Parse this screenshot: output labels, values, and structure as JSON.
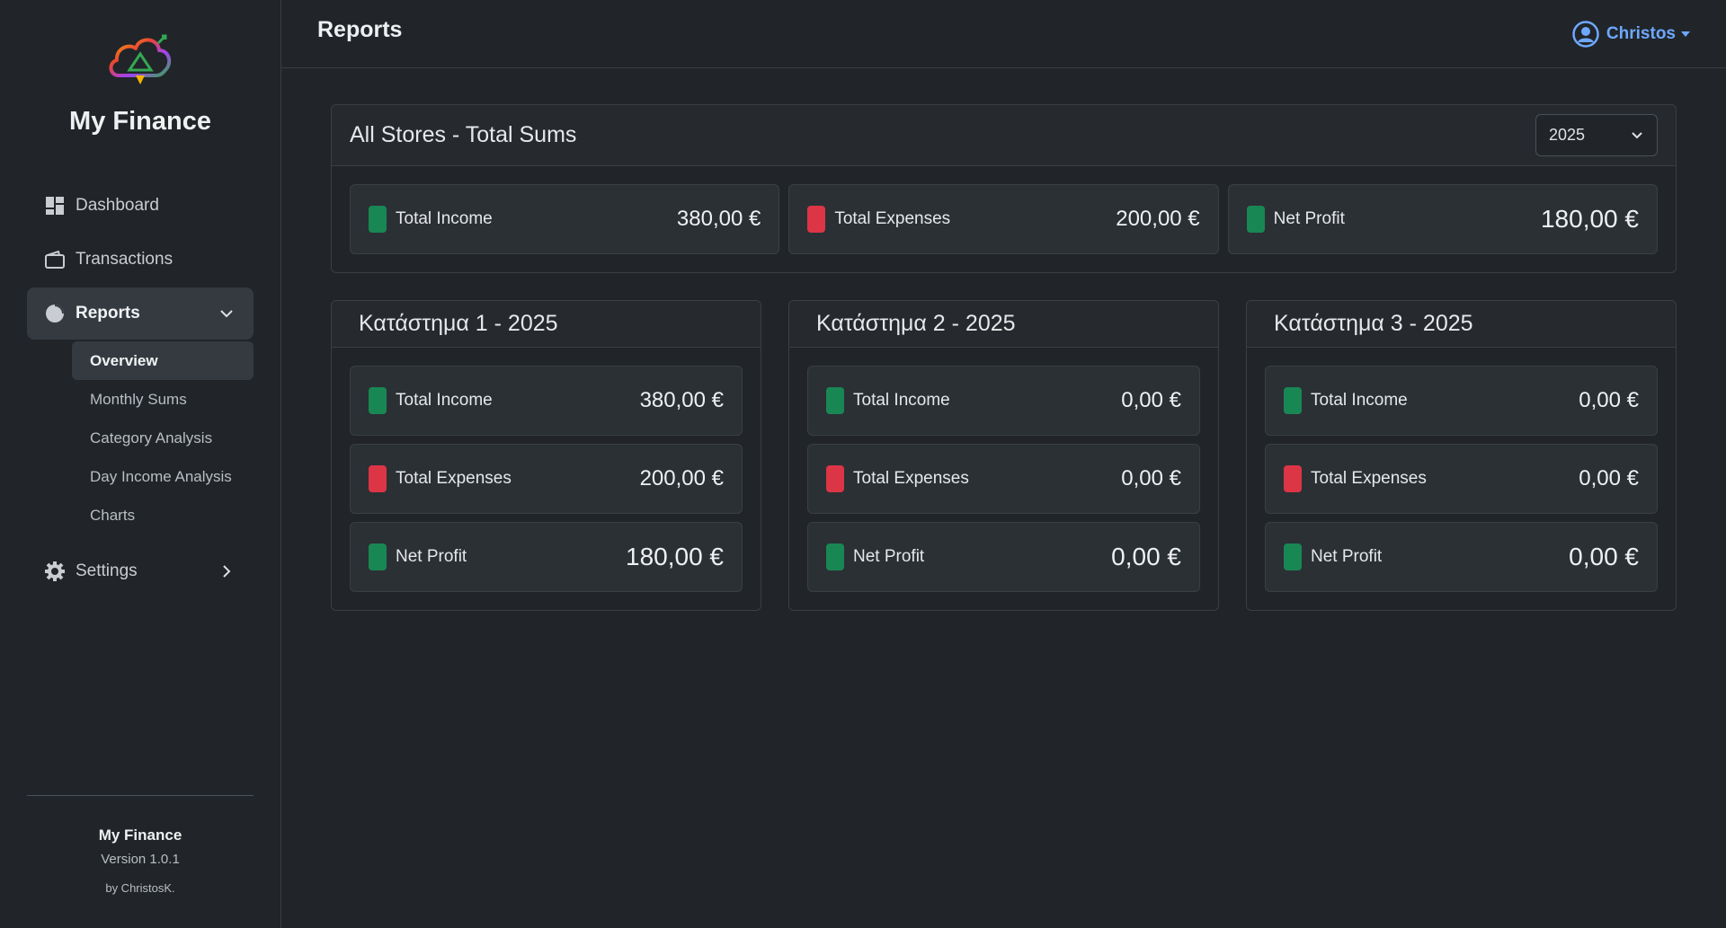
{
  "sidebar": {
    "brand": "My Finance",
    "nav": {
      "dashboard": "Dashboard",
      "transactions": "Transactions",
      "reports": "Reports",
      "settings": "Settings"
    },
    "subnav": [
      "Overview",
      "Monthly Sums",
      "Category Analysis",
      "Day Income Analysis",
      "Charts"
    ],
    "footer": {
      "name": "My Finance",
      "version": "Version 1.0.1",
      "by": "by ChristosK."
    }
  },
  "header": {
    "title": "Reports",
    "user": "Christos"
  },
  "summary": {
    "title": "All Stores - Total Sums",
    "year": "2025",
    "income_label": "Total Income",
    "income_value": "380,00 €",
    "expenses_label": "Total Expenses",
    "expenses_value": "200,00 €",
    "profit_label": "Net Profit",
    "profit_value": "180,00 €"
  },
  "stores": [
    {
      "title": "Κατάστημα 1 - 2025",
      "income_label": "Total Income",
      "income_value": "380,00 €",
      "expenses_label": "Total Expenses",
      "expenses_value": "200,00 €",
      "profit_label": "Net Profit",
      "profit_value": "180,00 €"
    },
    {
      "title": "Κατάστημα 2 - 2025",
      "income_label": "Total Income",
      "income_value": "0,00 €",
      "expenses_label": "Total Expenses",
      "expenses_value": "0,00 €",
      "profit_label": "Net Profit",
      "profit_value": "0,00 €"
    },
    {
      "title": "Κατάστημα 3 - 2025",
      "income_label": "Total Income",
      "income_value": "0,00 €",
      "expenses_label": "Total Expenses",
      "expenses_value": "0,00 €",
      "profit_label": "Net Profit",
      "profit_value": "0,00 €"
    }
  ],
  "colors": {
    "positive": "#198754",
    "negative": "#dc3545",
    "accent": "#6ea8fe"
  },
  "icons": {
    "dashboard": "dashboard-icon",
    "transactions": "wallet-icon",
    "reports": "pie-chart-icon",
    "settings": "gear-icon",
    "user": "user-circle-icon"
  }
}
